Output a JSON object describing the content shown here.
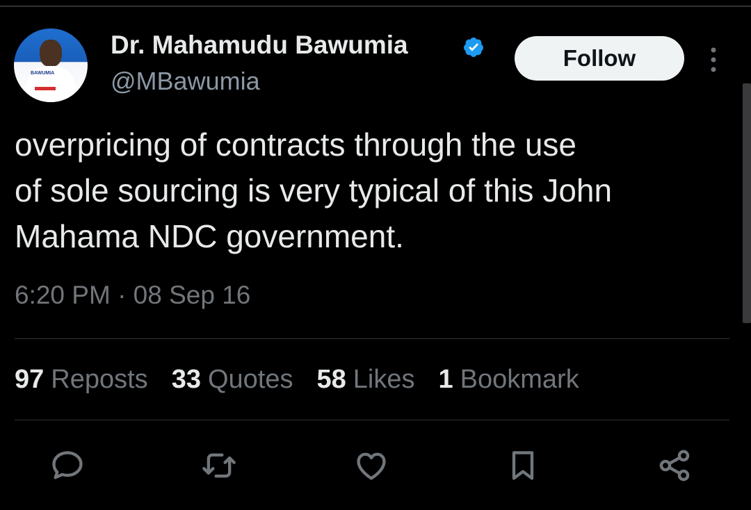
{
  "tweet": {
    "author_name": "Dr. Mahamudu Bawumia",
    "handle": "@MBawumia",
    "verified": true,
    "follow_label": "Follow",
    "text": "overpricing of contracts through the use of sole sourcing is very typical of this John Mahama NDC government.",
    "text_lines": [
      "overpricing of contracts through the use",
      "of sole sourcing is very typical of this John",
      "Mahama NDC government."
    ],
    "timestamp": "6:20 PM · 08 Sep 16",
    "avatar_text": "BAWUMIA"
  },
  "stats": [
    {
      "count": "97",
      "label": "Reposts"
    },
    {
      "count": "33",
      "label": "Quotes"
    },
    {
      "count": "58",
      "label": "Likes"
    },
    {
      "count": "1",
      "label": "Bookmark"
    }
  ],
  "actions": [
    "reply-icon",
    "repost-icon",
    "like-icon",
    "bookmark-icon",
    "share-icon"
  ],
  "colors": {
    "background": "#000000",
    "text_primary": "#e7e9ea",
    "text_secondary": "#71767b",
    "verified_blue": "#1d9bf0",
    "follow_bg": "#eff3f4"
  }
}
